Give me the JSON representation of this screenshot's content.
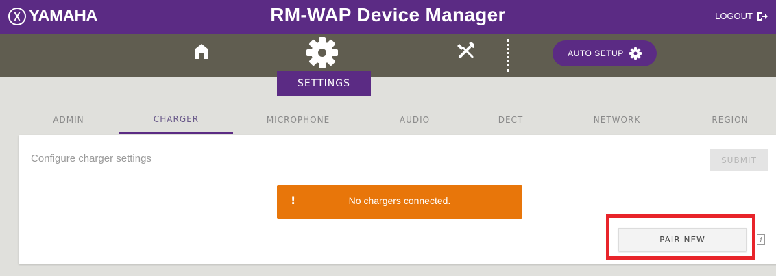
{
  "brand": {
    "logo_text": "YAMAHA",
    "app_title": "RM-WAP Device Manager",
    "logout_label": "LOGOUT"
  },
  "iconbar": {
    "home_icon": "home-icon",
    "settings_icon": "gear-icon",
    "tools_icon": "tools-icon",
    "auto_setup_label": "AUTO SETUP",
    "settings_label": "SETTINGS"
  },
  "tabs": [
    {
      "label": "ADMIN",
      "active": false
    },
    {
      "label": "CHARGER",
      "active": true
    },
    {
      "label": "MICROPHONE",
      "active": false
    },
    {
      "label": "AUDIO",
      "active": false
    },
    {
      "label": "DECT",
      "active": false
    },
    {
      "label": "NETWORK",
      "active": false
    },
    {
      "label": "REGION",
      "active": false
    }
  ],
  "panel": {
    "title": "Configure charger settings",
    "submit_label": "SUBMIT",
    "alert": {
      "icon": "!",
      "text": "No chargers connected."
    },
    "pair_new_label": "PAIR NEW",
    "info_icon": "i"
  },
  "colors": {
    "primary": "#5b2b84",
    "iconbar": "#605d50",
    "alert": "#e8760a",
    "highlight": "#e8242a"
  }
}
